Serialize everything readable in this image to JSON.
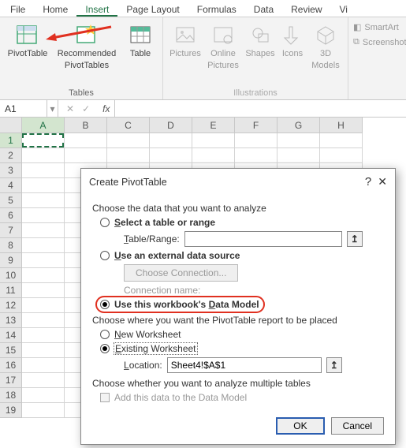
{
  "menubar": {
    "file": "File",
    "home": "Home",
    "insert": "Insert",
    "pagelayout": "Page Layout",
    "formulas": "Formulas",
    "data": "Data",
    "review": "Review",
    "vi": "Vi"
  },
  "ribbon": {
    "tables_label": "Tables",
    "pivot": "PivotTable",
    "recommended1": "Recommended",
    "recommended2": "PivotTables",
    "table": "Table",
    "illus_label": "Illustrations",
    "pictures": "Pictures",
    "online_pics1": "Online",
    "online_pics2": "Pictures",
    "shapes": "Shapes",
    "icons": "Icons",
    "models1": "3D",
    "models2": "Models",
    "smartart": "SmartArt",
    "screenshot": "Screenshot"
  },
  "namebox": "A1",
  "fx": "fx",
  "cols": [
    "A",
    "B",
    "C",
    "D",
    "E",
    "F",
    "G",
    "H"
  ],
  "rows": [
    "1",
    "2",
    "3",
    "4",
    "5",
    "6",
    "7",
    "8",
    "9",
    "10",
    "11",
    "12",
    "13",
    "14",
    "15",
    "16",
    "17",
    "18",
    "19"
  ],
  "dialog": {
    "title": "Create PivotTable",
    "help": "?",
    "close": "✕",
    "analyze_header": "Choose the data that you want to analyze",
    "opt_select": "Select a table or range",
    "table_range_label": "Table/Range:",
    "table_range_value": "",
    "opt_external": "Use an external data source",
    "choose_conn": "Choose Connection...",
    "conn_name_label": "Connection name:",
    "opt_datamodel": "Use this workbook's Data Model",
    "place_header": "Choose where you want the PivotTable report to be placed",
    "opt_new_ws": "New Worksheet",
    "opt_existing_ws": "Existing Worksheet",
    "location_label": "Location:",
    "location_value": "Sheet4!$A$1",
    "multi_header": "Choose whether you want to analyze multiple tables",
    "add_data_model": "Add this data to the Data Model",
    "ok": "OK",
    "cancel": "Cancel",
    "picker": "↥"
  }
}
